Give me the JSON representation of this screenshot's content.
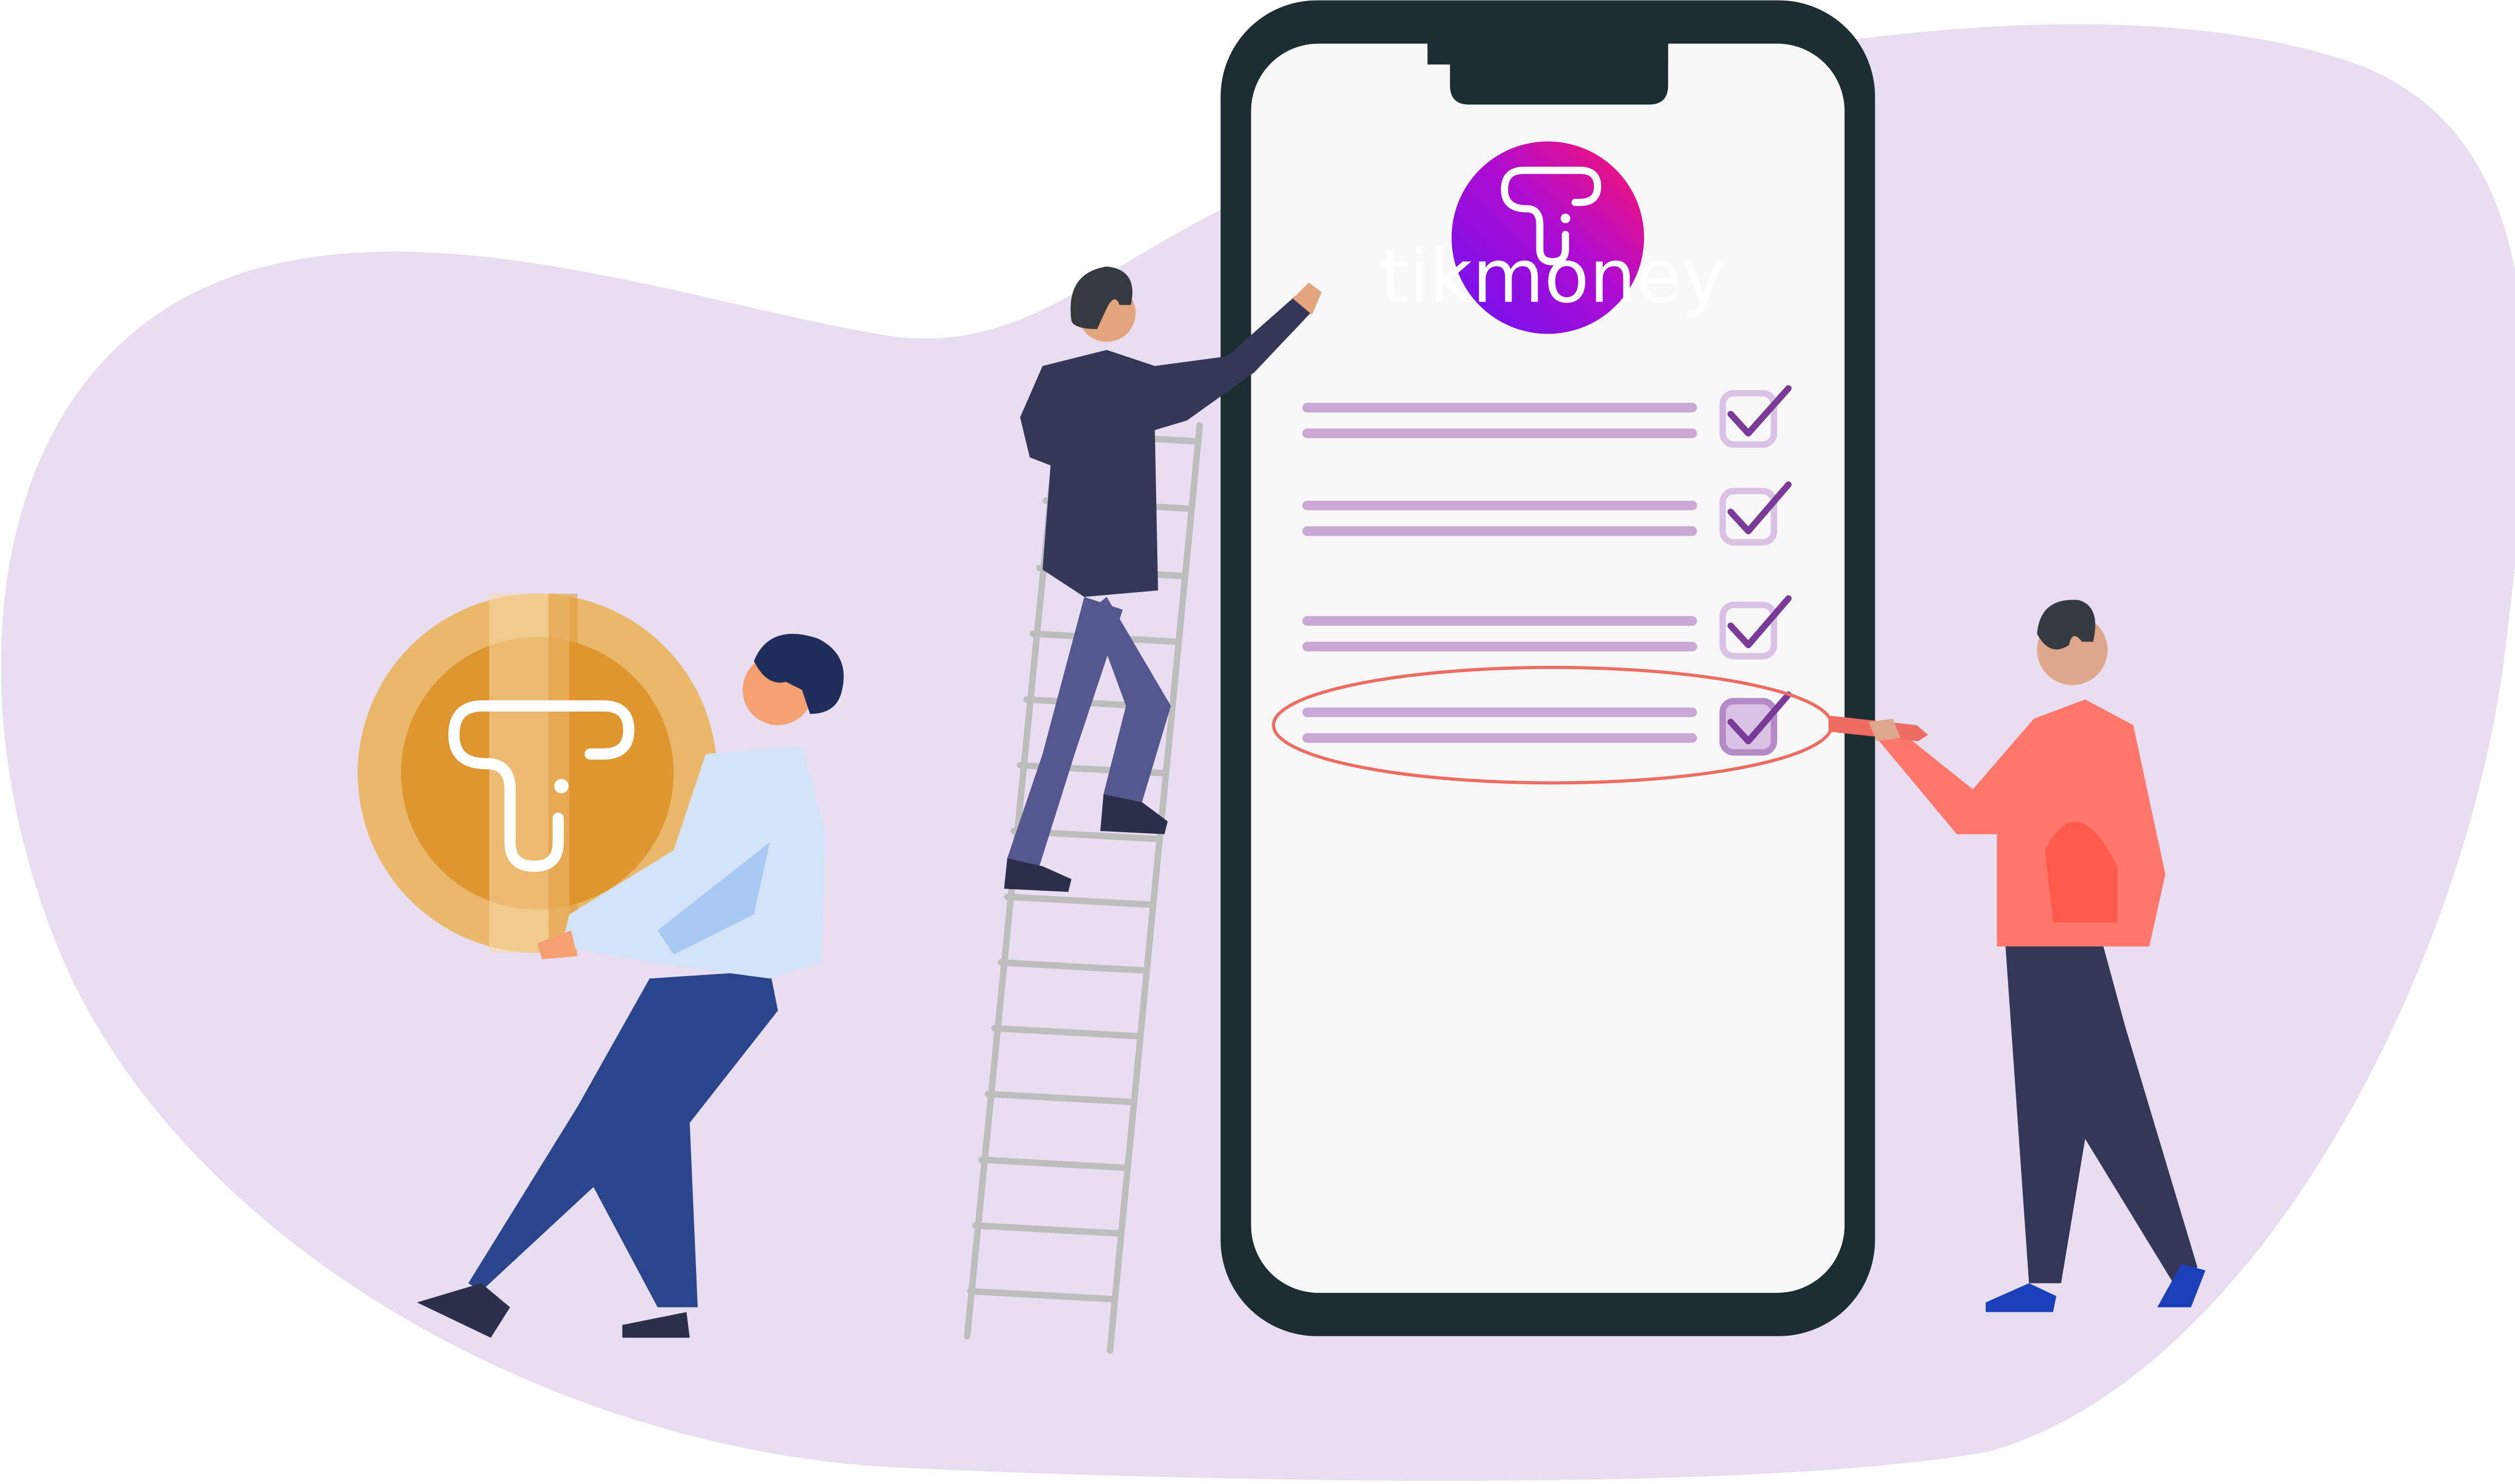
{
  "brand": {
    "app_name": "tikmoney",
    "logo_icon": "tikmoney-logo-icon",
    "gradient_colors": [
      "#7b10f0",
      "#f0107a"
    ]
  },
  "checklist": {
    "items": [
      {
        "checked": true,
        "highlighted": false
      },
      {
        "checked": true,
        "highlighted": false
      },
      {
        "checked": true,
        "highlighted": false
      },
      {
        "checked": true,
        "highlighted": true
      }
    ]
  },
  "colors": {
    "background_blob": "#e8ddf1",
    "phone_frame": "#1d2e33",
    "phone_screen": "#f8f8f8",
    "checklist_line": "#c9a8d4",
    "check_mark": "#7a3a98",
    "highlight_ellipse": "#ef6c62",
    "coin": "#e0962f"
  },
  "icons": [
    "coin-icon",
    "ladder-icon",
    "pencil-icon",
    "check-icon"
  ]
}
